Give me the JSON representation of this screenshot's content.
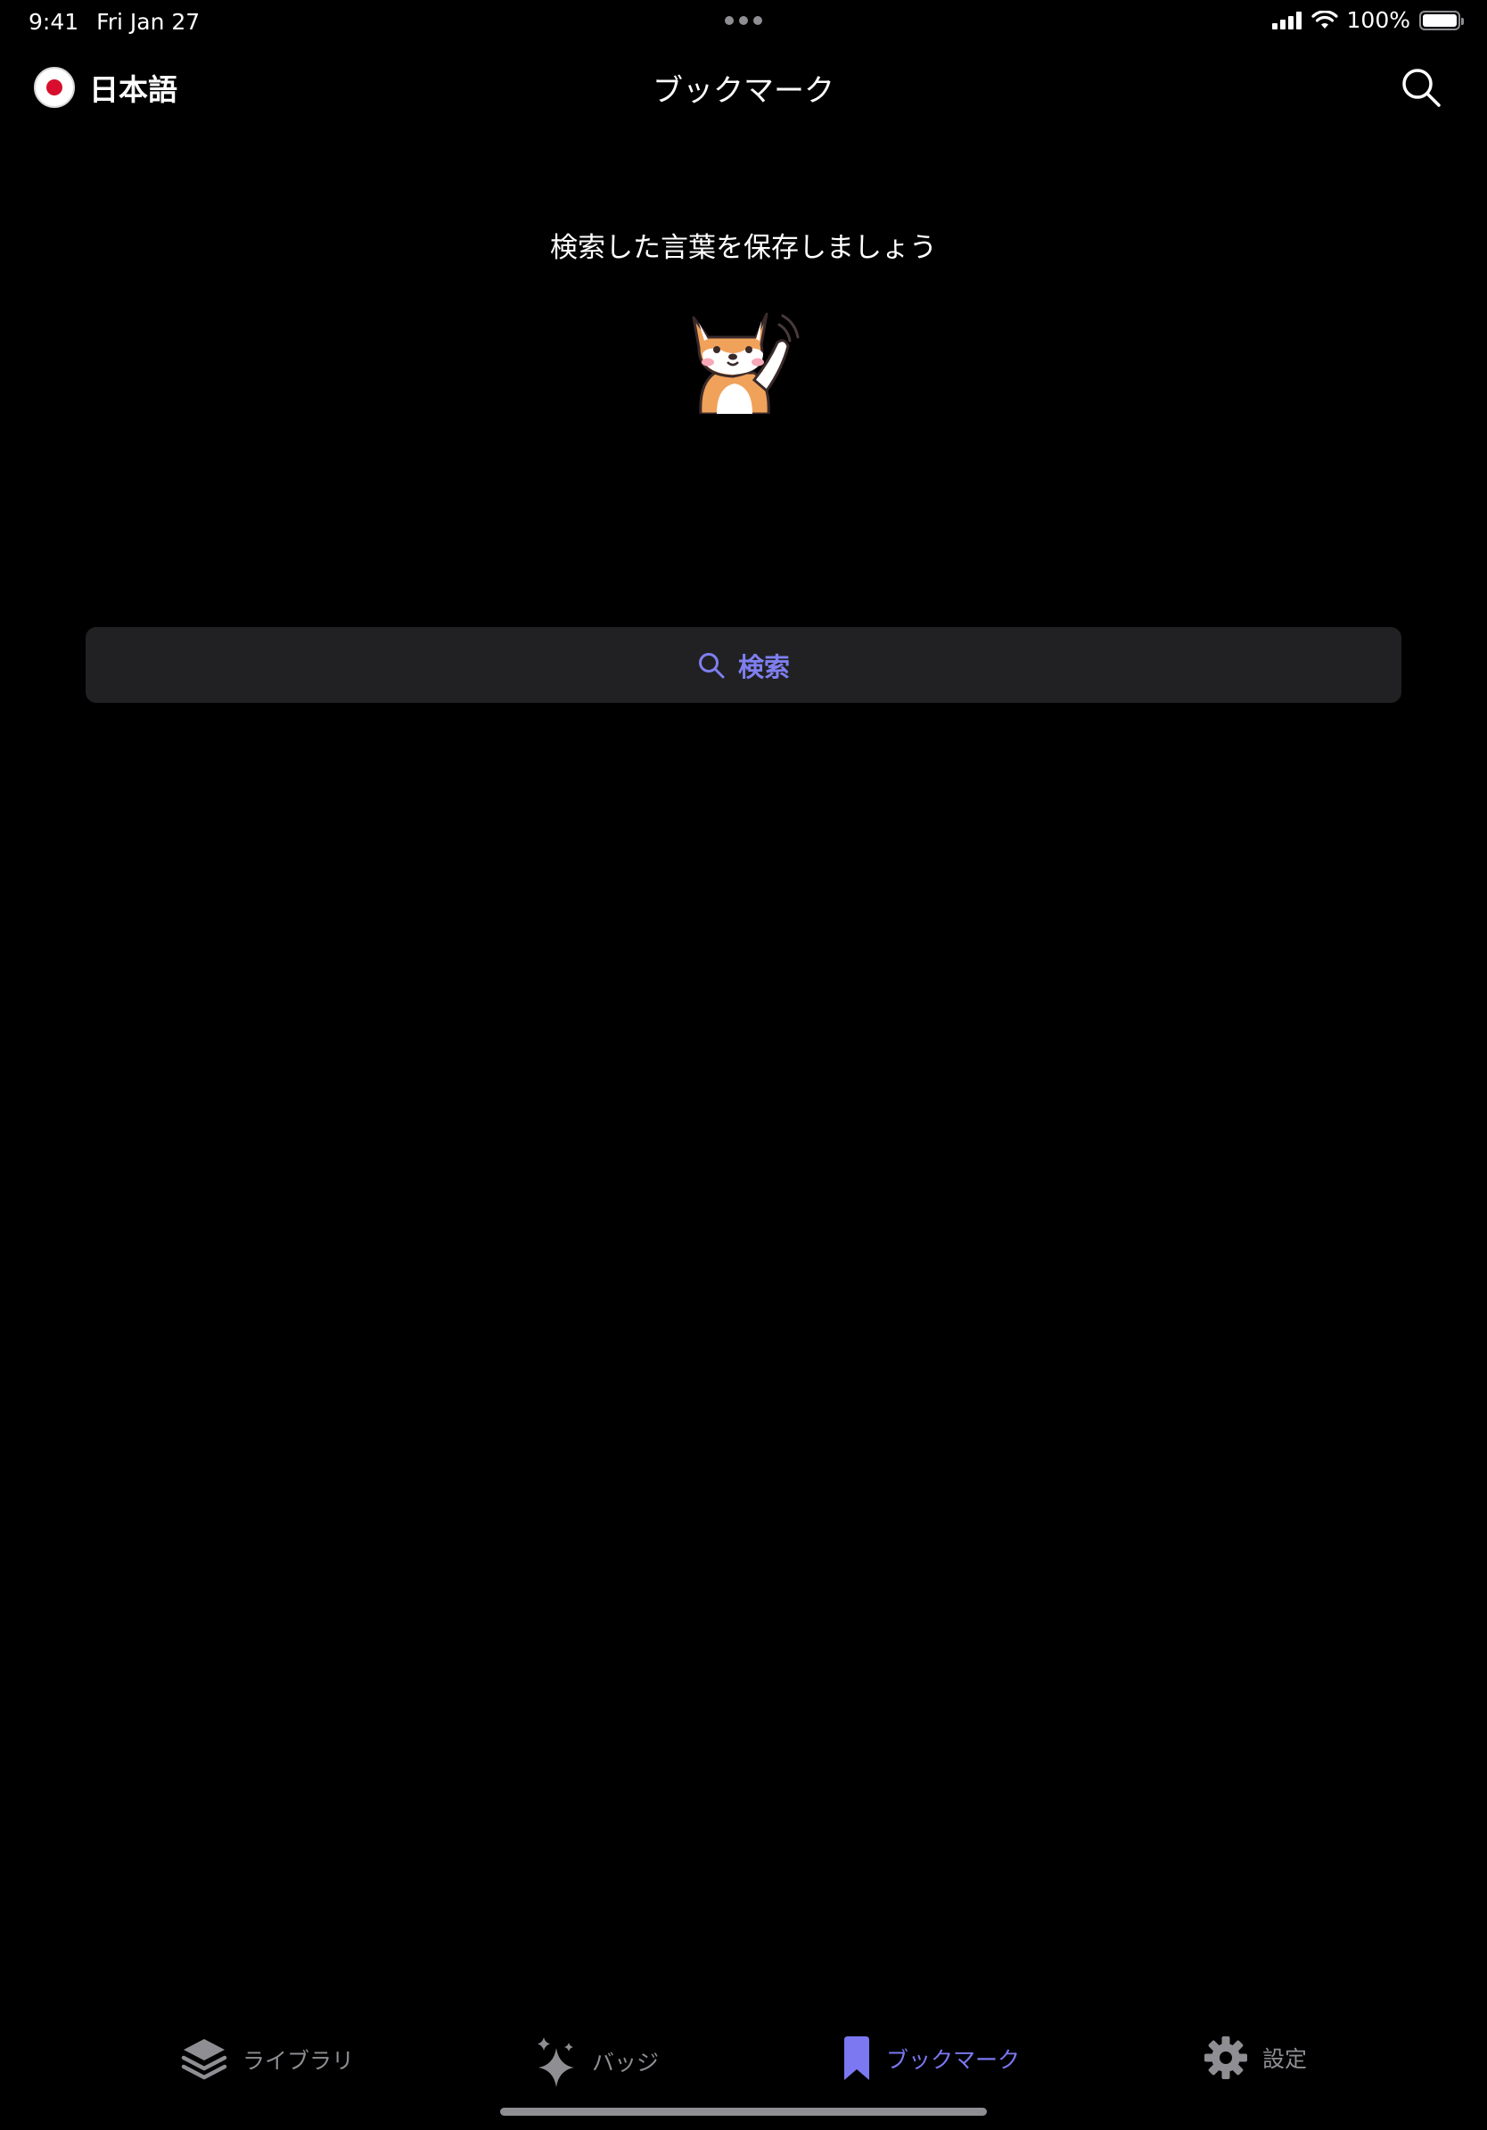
{
  "status_bar": {
    "time": "9:41",
    "date": "Fri Jan 27",
    "battery_text": "100%",
    "battery_level": 1.0
  },
  "nav": {
    "language_label": "日本語",
    "title": "ブックマーク",
    "search_icon": "search-icon"
  },
  "empty_state": {
    "prompt": "検索した言葉を保存しましょう",
    "mascot": "shiba-dog-waving"
  },
  "search_button": {
    "label": "検索",
    "icon": "search-icon"
  },
  "tabs": [
    {
      "label": "ライブラリ",
      "icon": "layers-icon",
      "active": false
    },
    {
      "label": "バッジ",
      "icon": "sparkles-icon",
      "active": false
    },
    {
      "label": "ブックマーク",
      "icon": "bookmark-icon",
      "active": true
    },
    {
      "label": "設定",
      "icon": "gear-icon",
      "active": false
    }
  ],
  "colors": {
    "background": "#000000",
    "accent": "#7b78f2",
    "inactive": "#8e8e93",
    "button_bg": "#212124"
  }
}
